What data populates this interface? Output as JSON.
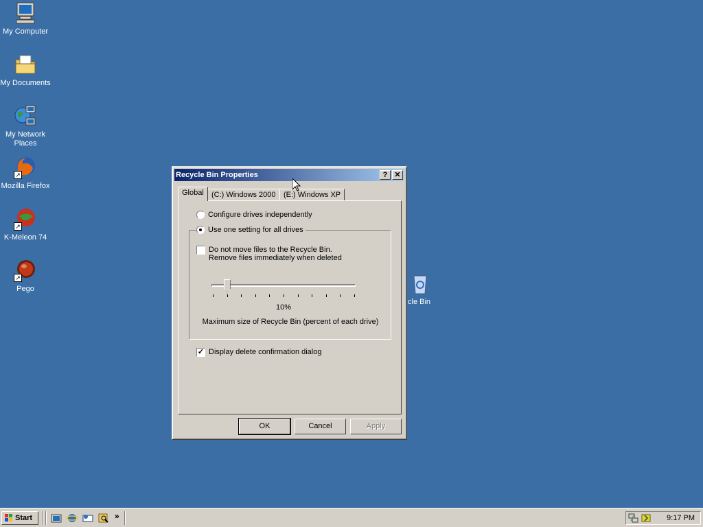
{
  "desktop": {
    "icons": [
      {
        "label": "My Computer"
      },
      {
        "label": "My Documents"
      },
      {
        "label": "My Network\nPlaces"
      },
      {
        "label": "Mozilla Firefox"
      },
      {
        "label": "K-Meleon 74"
      },
      {
        "label": "Pego"
      },
      {
        "label": "cle Bin"
      }
    ]
  },
  "dialog": {
    "title": "Recycle Bin Properties",
    "help_button": "?",
    "close_button": "✕",
    "tabs": [
      {
        "label": "Global",
        "active": true
      },
      {
        "label": "(C:) Windows 2000",
        "active": false
      },
      {
        "label": "(E:) Windows XP",
        "active": false
      }
    ],
    "radio_independent": "Configure drives independently",
    "radio_one_setting": "Use one setting for all drives",
    "selected_radio": "Use one setting for all drives",
    "no_move_line1": "Do not move files to the Recycle Bin.",
    "no_move_line2": "Remove files immediately when deleted",
    "no_move_checked": false,
    "slider_value_label": "10%",
    "slider_value": 0.1,
    "slider_caption": "Maximum size of Recycle Bin (percent of each drive)",
    "confirm_label": "Display delete confirmation dialog",
    "confirm_checked": true,
    "buttons": {
      "ok": "OK",
      "cancel": "Cancel",
      "apply": "Apply"
    }
  },
  "taskbar": {
    "start_label": "Start",
    "chevron": "»",
    "clock": "9:17 PM"
  },
  "colors": {
    "desktop": "#3a6ea5",
    "title_start": "#0a246a",
    "title_end": "#a6caf0",
    "face": "#d4d0c8"
  }
}
